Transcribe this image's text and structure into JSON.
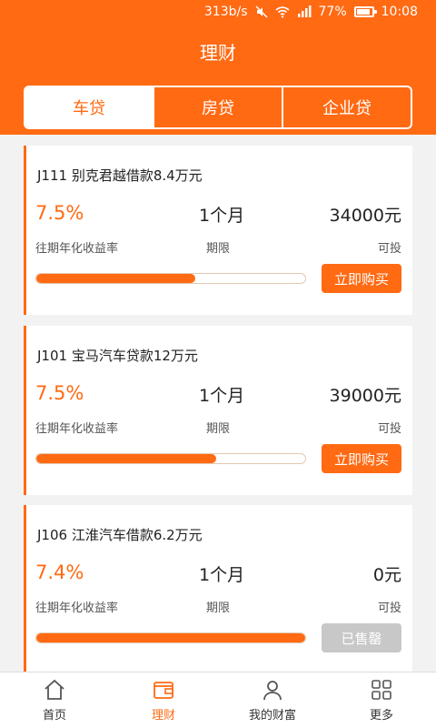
{
  "status_bar": {
    "speed": "313b/s",
    "battery": "77%",
    "time": "10:08"
  },
  "header": {
    "title": "理财",
    "tabs": [
      "车贷",
      "房贷",
      "企业贷"
    ],
    "active_tab": 0
  },
  "loans": [
    {
      "title": "J111 别克君越借款8.4万元",
      "rate": "7.5%",
      "rate_label": "往期年化收益率",
      "term": "1个月",
      "term_label": "期限",
      "amount": "34000元",
      "amount_label": "可投",
      "progress": 0.59,
      "button": "立即购买",
      "sold_out": false
    },
    {
      "title": "J101 宝马汽车贷款12万元",
      "rate": "7.5%",
      "rate_label": "往期年化收益率",
      "term": "1个月",
      "term_label": "期限",
      "amount": "39000元",
      "amount_label": "可投",
      "progress": 0.67,
      "button": "立即购买",
      "sold_out": false
    },
    {
      "title": "J106 江淮汽车借款6.2万元",
      "rate": "7.4%",
      "rate_label": "往期年化收益率",
      "term": "1个月",
      "term_label": "期限",
      "amount": "0元",
      "amount_label": "可投",
      "progress": 1.0,
      "button": "已售罄",
      "sold_out": true
    }
  ],
  "bottom_nav": [
    {
      "label": "首页",
      "icon": "home-icon"
    },
    {
      "label": "理财",
      "icon": "wallet-icon"
    },
    {
      "label": "我的财富",
      "icon": "user-icon"
    },
    {
      "label": "更多",
      "icon": "grid-icon"
    }
  ],
  "colors": {
    "accent": "#ff6a13",
    "soldout": "#c8c8c8"
  }
}
